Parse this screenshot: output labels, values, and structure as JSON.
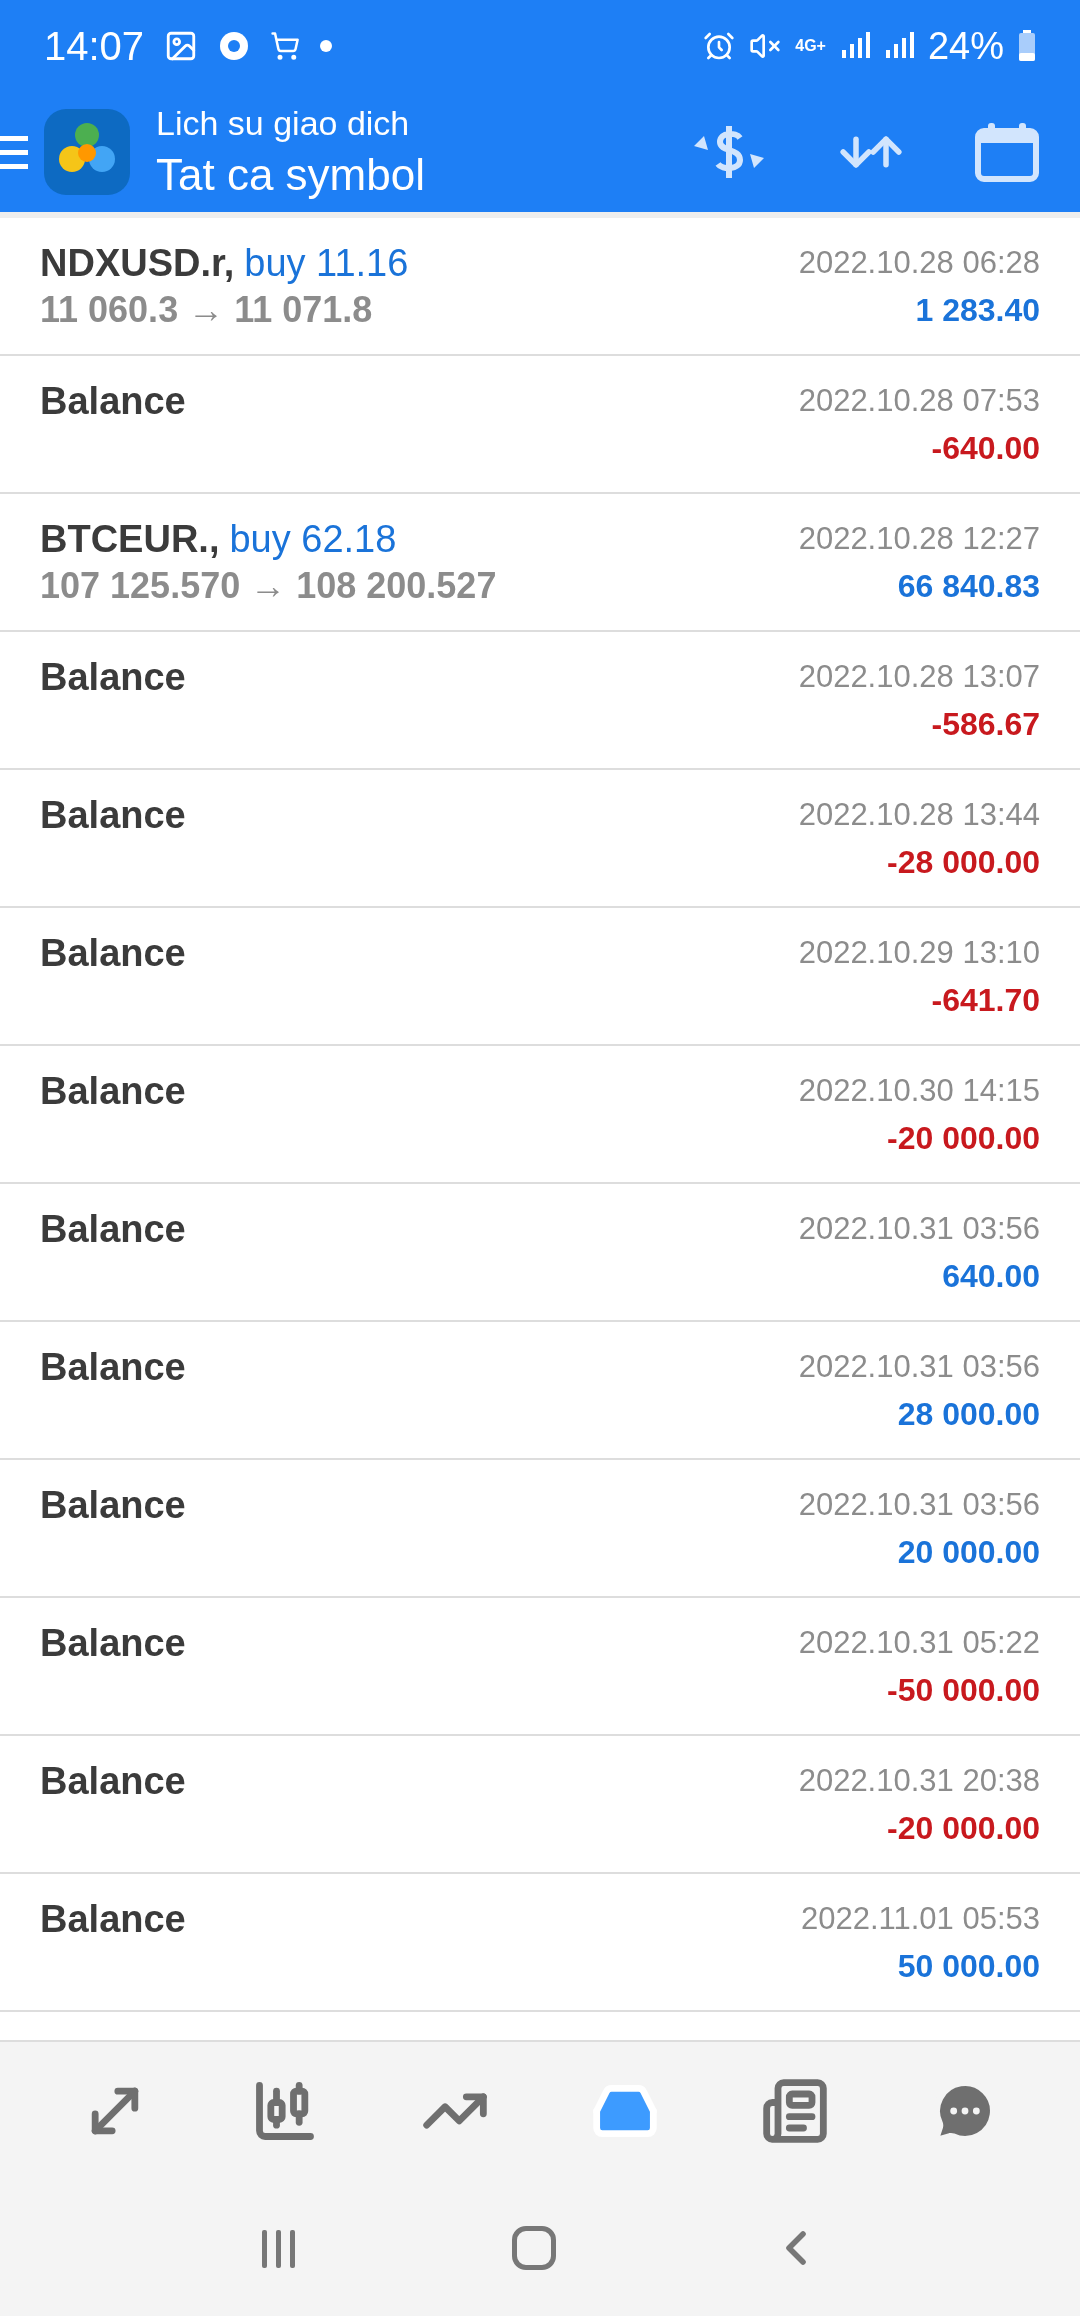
{
  "status_bar": {
    "time": "14:07",
    "network": "4G+",
    "battery": "24%"
  },
  "header": {
    "subtitle": "Lich su giao dich",
    "title": "Tat ca symbol"
  },
  "rows": [
    {
      "kind": "trade",
      "symbol": "NDXUSD.r,",
      "order": "buy 11.16",
      "prices": "11 060.3 → 11 071.8",
      "time": "2022.10.28 06:28",
      "amount": "1 283.40",
      "profit": true
    },
    {
      "kind": "balance",
      "label": "Balance",
      "time": "2022.10.28 07:53",
      "amount": "-640.00",
      "profit": false
    },
    {
      "kind": "trade",
      "symbol": "BTCEUR.,",
      "order": "buy 62.18",
      "prices": "107 125.570 → 108 200.527",
      "time": "2022.10.28 12:27",
      "amount": "66 840.83",
      "profit": true
    },
    {
      "kind": "balance",
      "label": "Balance",
      "time": "2022.10.28 13:07",
      "amount": "-586.67",
      "profit": false
    },
    {
      "kind": "balance",
      "label": "Balance",
      "time": "2022.10.28 13:44",
      "amount": "-28 000.00",
      "profit": false
    },
    {
      "kind": "balance",
      "label": "Balance",
      "time": "2022.10.29 13:10",
      "amount": "-641.70",
      "profit": false
    },
    {
      "kind": "balance",
      "label": "Balance",
      "time": "2022.10.30 14:15",
      "amount": "-20 000.00",
      "profit": false
    },
    {
      "kind": "balance",
      "label": "Balance",
      "time": "2022.10.31 03:56",
      "amount": "640.00",
      "profit": true
    },
    {
      "kind": "balance",
      "label": "Balance",
      "time": "2022.10.31 03:56",
      "amount": "28 000.00",
      "profit": true
    },
    {
      "kind": "balance",
      "label": "Balance",
      "time": "2022.10.31 03:56",
      "amount": "20 000.00",
      "profit": true
    },
    {
      "kind": "balance",
      "label": "Balance",
      "time": "2022.10.31 05:22",
      "amount": "-50 000.00",
      "profit": false
    },
    {
      "kind": "balance",
      "label": "Balance",
      "time": "2022.10.31 20:38",
      "amount": "-20 000.00",
      "profit": false
    },
    {
      "kind": "balance",
      "label": "Balance",
      "time": "2022.11.01 05:53",
      "amount": "50 000.00",
      "profit": true
    }
  ],
  "bottom_nav": [
    {
      "kind": "quotes",
      "selected": false
    },
    {
      "kind": "chart",
      "selected": false
    },
    {
      "kind": "trade",
      "selected": false
    },
    {
      "kind": "history",
      "selected": true
    },
    {
      "kind": "news",
      "selected": false
    },
    {
      "kind": "chat",
      "selected": false
    }
  ]
}
